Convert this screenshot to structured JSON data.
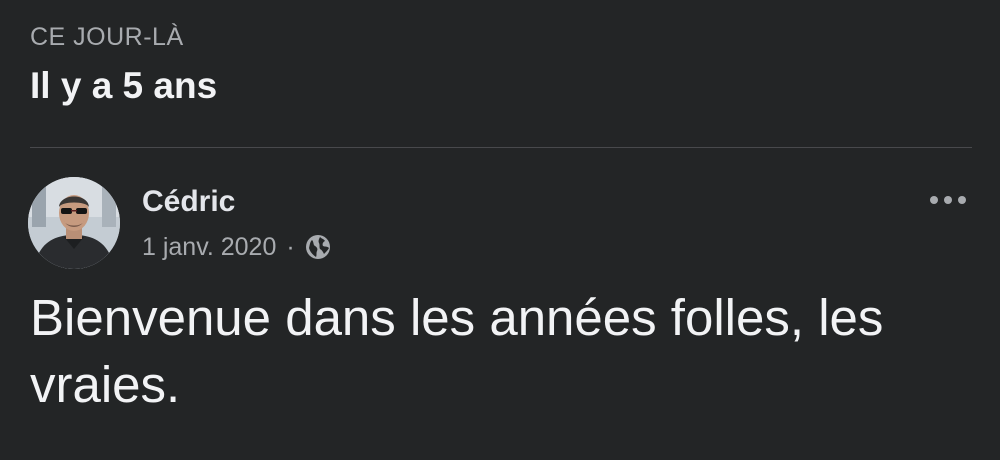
{
  "memory": {
    "section_label": "CE JOUR-LÀ",
    "title": "Il y a 5 ans"
  },
  "post": {
    "author": "Cédric",
    "date": "1 janv. 2020",
    "separator": "·",
    "audience_icon": "globe-icon",
    "menu_icon": "more-horizontal-icon",
    "text": "Bienvenue dans les années folles, les vraies."
  },
  "colors": {
    "background": "#232526",
    "primary_text": "#e4e6eb",
    "secondary_text": "#a8abaf",
    "divider": "#48494c"
  }
}
